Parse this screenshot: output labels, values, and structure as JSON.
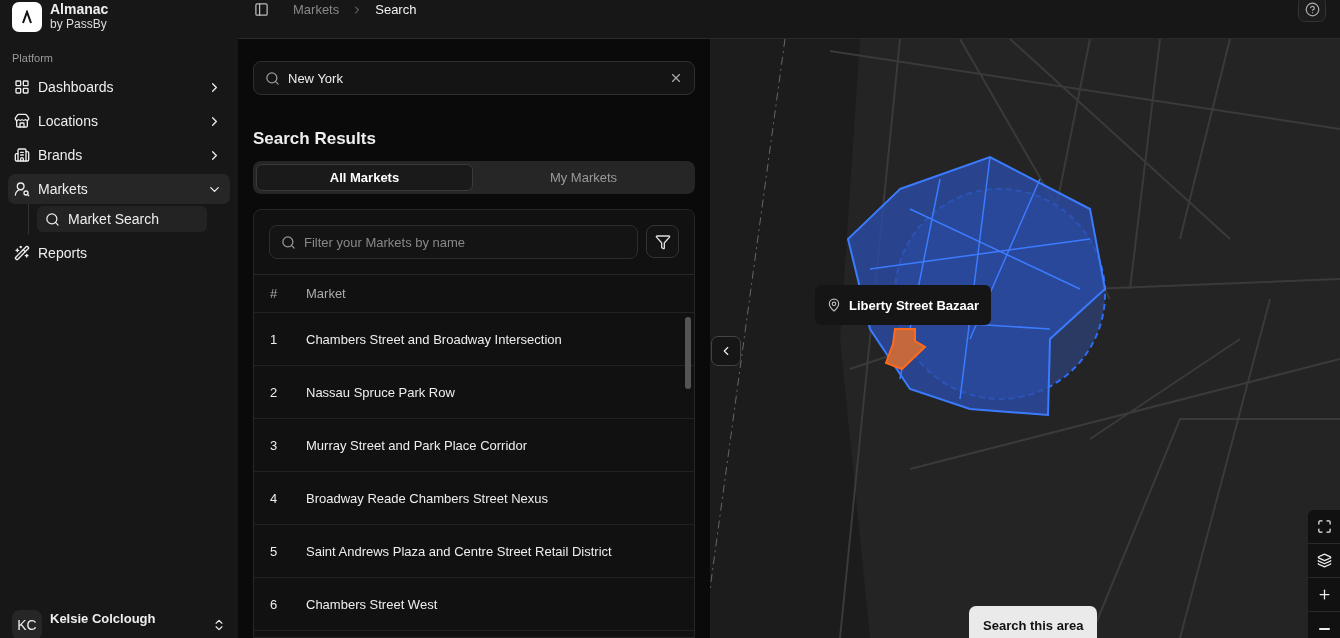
{
  "brand": {
    "name": "Almanac",
    "subtitle": "by PassBy"
  },
  "sidebar": {
    "section": "Platform",
    "items": [
      {
        "label": "Dashboards",
        "expanded": false,
        "selected": false
      },
      {
        "label": "Locations",
        "expanded": false,
        "selected": false
      },
      {
        "label": "Brands",
        "expanded": false,
        "selected": false
      },
      {
        "label": "Markets",
        "expanded": true,
        "selected": true,
        "children": [
          {
            "label": "Market Search",
            "selected": true
          }
        ]
      },
      {
        "label": "Reports",
        "selected": false
      }
    ]
  },
  "user": {
    "initials": "KC",
    "name": "Kelsie Colclough"
  },
  "breadcrumbs": [
    {
      "label": "Markets",
      "selected": false
    },
    {
      "label": "Search",
      "selected": true
    }
  ],
  "search": {
    "value": "New York"
  },
  "results_title": "Search Results",
  "tabs": [
    {
      "label": "All Markets",
      "selected": true
    },
    {
      "label": "My Markets",
      "selected": false
    }
  ],
  "filter": {
    "placeholder": "Filter your Markets by name"
  },
  "table": {
    "columns": [
      "#",
      "Market"
    ],
    "rows": [
      [
        "1",
        "Chambers Street and Broadway Intersection"
      ],
      [
        "2",
        "Nassau Spruce Park Row"
      ],
      [
        "3",
        "Murray Street and Park Place Corridor"
      ],
      [
        "4",
        "Broadway Reade Chambers Street Nexus"
      ],
      [
        "5",
        "Saint Andrews Plaza and Centre Street Retail District"
      ],
      [
        "6",
        "Chambers Street West"
      ]
    ]
  },
  "map": {
    "tooltip": "Liberty Street Bazaar",
    "search_area_button": "Search this area"
  }
}
